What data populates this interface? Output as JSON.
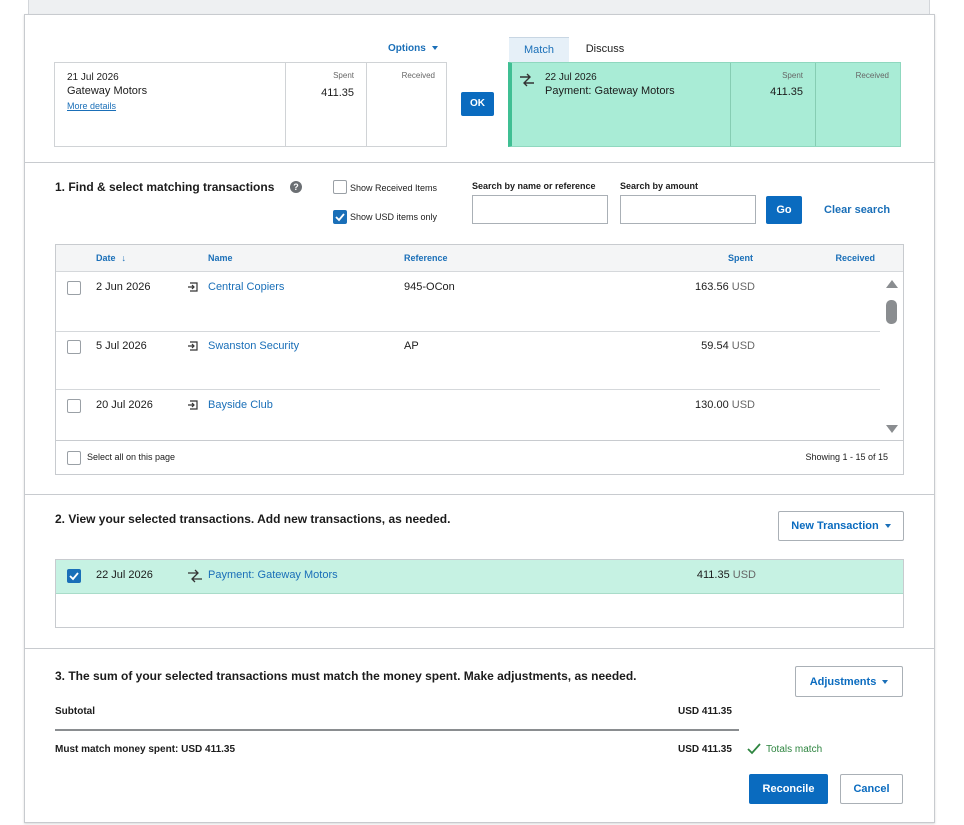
{
  "header": {
    "options_label": "Options",
    "tabs": [
      {
        "label": "Match"
      },
      {
        "label": "Discuss"
      }
    ],
    "ok_label": "OK"
  },
  "statement_line": {
    "date": "21 Jul 2026",
    "payee": "Gateway Motors",
    "details_link": "More details",
    "spent_label": "Spent",
    "received_label": "Received",
    "spent": "411.35"
  },
  "matched_line": {
    "date": "22 Jul 2026",
    "description": "Payment: Gateway Motors",
    "spent_label": "Spent",
    "received_label": "Received",
    "spent": "411.35"
  },
  "section1": {
    "title": "1. Find & select matching transactions",
    "show_received_label": "Show Received Items",
    "show_usd_label": "Show USD items only",
    "search_name_label": "Search by name or reference",
    "search_amount_label": "Search by amount",
    "go_label": "Go",
    "clear_label": "Clear search",
    "columns": {
      "date": "Date",
      "name": "Name",
      "reference": "Reference",
      "spent": "Spent",
      "received": "Received"
    },
    "rows": [
      {
        "date": "2 Jun 2026",
        "name": "Central Copiers",
        "reference": "945-OCon",
        "spent": "163.56",
        "currency": "USD"
      },
      {
        "date": "5 Jul 2026",
        "name": "Swanston Security",
        "reference": "AP",
        "spent": "59.54",
        "currency": "USD"
      },
      {
        "date": "20 Jul 2026",
        "name": "Bayside Club",
        "reference": "",
        "spent": "130.00",
        "currency": "USD"
      }
    ],
    "select_all_label": "Select all on this page",
    "showing_label": "Showing 1 - 15 of 15"
  },
  "section2": {
    "title": "2. View your selected transactions. Add new transactions, as needed.",
    "new_transaction_label": "New Transaction",
    "selected": {
      "date": "22 Jul 2026",
      "name": "Payment: Gateway Motors",
      "spent": "411.35",
      "currency": "USD"
    }
  },
  "section3": {
    "title": "3. The sum of your selected transactions must match the money spent. Make adjustments, as needed.",
    "adjustments_label": "Adjustments",
    "subtotal_label": "Subtotal",
    "subtotal_value": "USD 411.35",
    "must_match_label": "Must match money spent: USD 411.35",
    "must_match_value": "USD 411.35",
    "totals_match_label": "Totals match",
    "reconcile_label": "Reconcile",
    "cancel_label": "Cancel"
  },
  "colors": {
    "accent": "#0a6bbf",
    "match_green": "#a9ecd6",
    "selected_row": "#c6f2e3",
    "success": "#2e8540"
  }
}
